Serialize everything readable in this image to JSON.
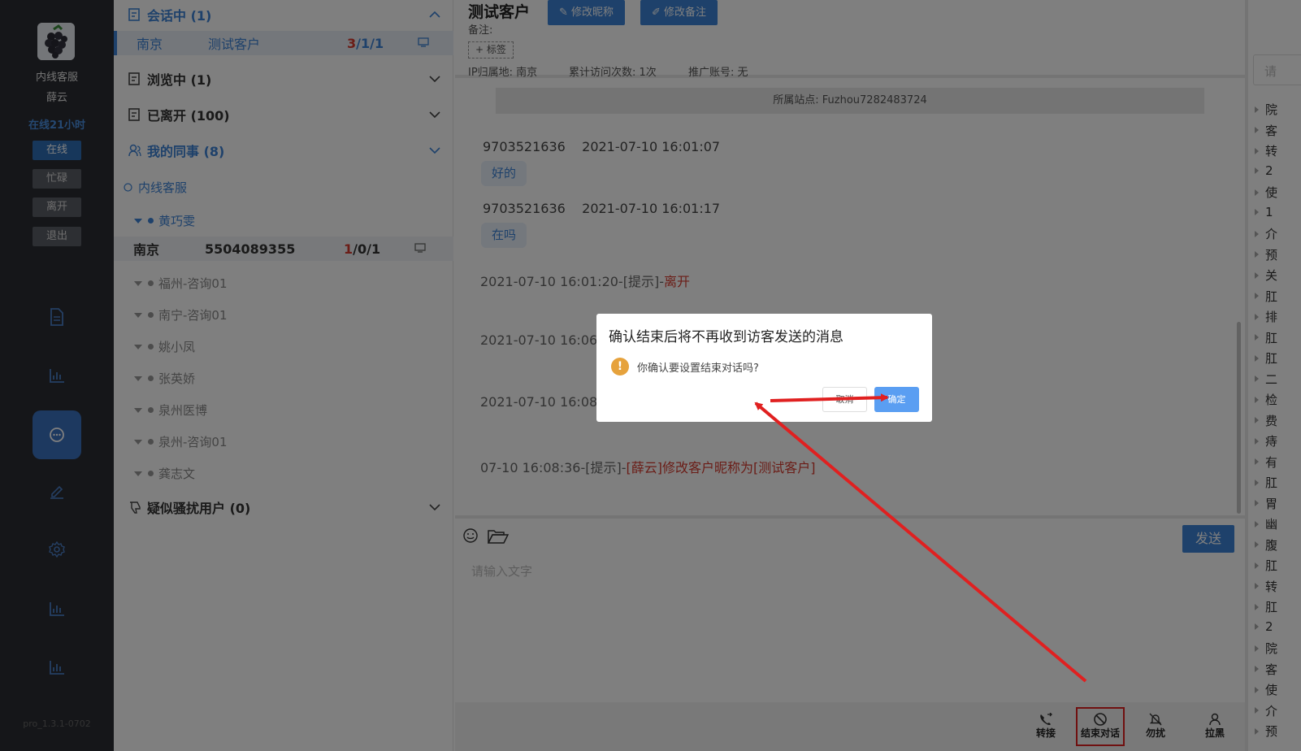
{
  "agent": {
    "name_line1": "内线客服",
    "name_line2": "薛云",
    "online_time": "在线21小时",
    "statuses": [
      "在线",
      "忙碌",
      "离开",
      "退出"
    ],
    "version": "pro_1.3.1-0702"
  },
  "sessions": {
    "active": "会话中 (1)",
    "browsing": "浏览中 (1)",
    "left": "已离开 (100)",
    "colleagues": "我的同事 (8)",
    "inline_cs": "内线客服",
    "suspected": "疑似骚扰用户 (0)"
  },
  "active_row": {
    "location": "南京",
    "name": "测试客户",
    "count_red": "3",
    "count_rest": "/1/1"
  },
  "colleague_top": "黄巧雯",
  "colleague_row": {
    "location": "南京",
    "name": "5504089355",
    "count_red": "1",
    "count_rest": "/0/1"
  },
  "colleagues": [
    "福州-咨询01",
    "南宁-咨询01",
    "姚小凤",
    "张英娇",
    "泉州医博",
    "泉州-咨询01",
    "龚志文"
  ],
  "chat": {
    "customer_name": "测试客户",
    "edit_nickname": "修改昵称",
    "edit_remark": "修改备注",
    "remark_label": "备注:",
    "tag_button": "+ 标签",
    "ip_location": "IP归属地: 南京",
    "visit_count": "累计访问次数: 1次",
    "promo_account": "推广账号: 无",
    "site": "所属站点: Fuzhou7282483724",
    "messages": [
      {
        "sender": "9703521636",
        "time": "2021-07-10 16:01:07",
        "text": "好的"
      },
      {
        "sender": "9703521636",
        "time": "2021-07-10 16:01:17",
        "text": "在吗"
      }
    ],
    "system1_prefix": "2021-07-10 16:01:20-[提示]-",
    "system1_highlight": "离开",
    "system2": "2021-07-10 16:06:2",
    "system3": "2021-07-10 16:08:2",
    "system4_prefix": "07-10 16:08:36-[提示]-",
    "system4_highlight": "[薛云]修改客户昵称为[测试客户]",
    "send_label": "发送",
    "input_placeholder": "请输入文字",
    "actions": [
      "转接",
      "结束对话",
      "勿扰",
      "拉黑"
    ]
  },
  "right_panel": {
    "search_placeholder": "请",
    "items": [
      "院",
      "客",
      "转",
      "2",
      "使",
      "1",
      "介",
      "预",
      "关",
      "肛",
      "排",
      "肛",
      "肛",
      "二",
      "检",
      "费",
      "痔",
      "有",
      "肛",
      "胃",
      "幽",
      "腹",
      "肛",
      "转",
      "肛",
      "2",
      "院",
      "客",
      "使",
      "介",
      "预"
    ]
  },
  "dialog": {
    "title": "确认结束后将不再收到访客发送的消息",
    "message": "你确认要设置结束对话吗?",
    "cancel": "取消",
    "confirm": "确定"
  },
  "colors": {
    "accent": "#3d83d6",
    "alert": "#d63b2f",
    "annotation": "#e02020"
  }
}
